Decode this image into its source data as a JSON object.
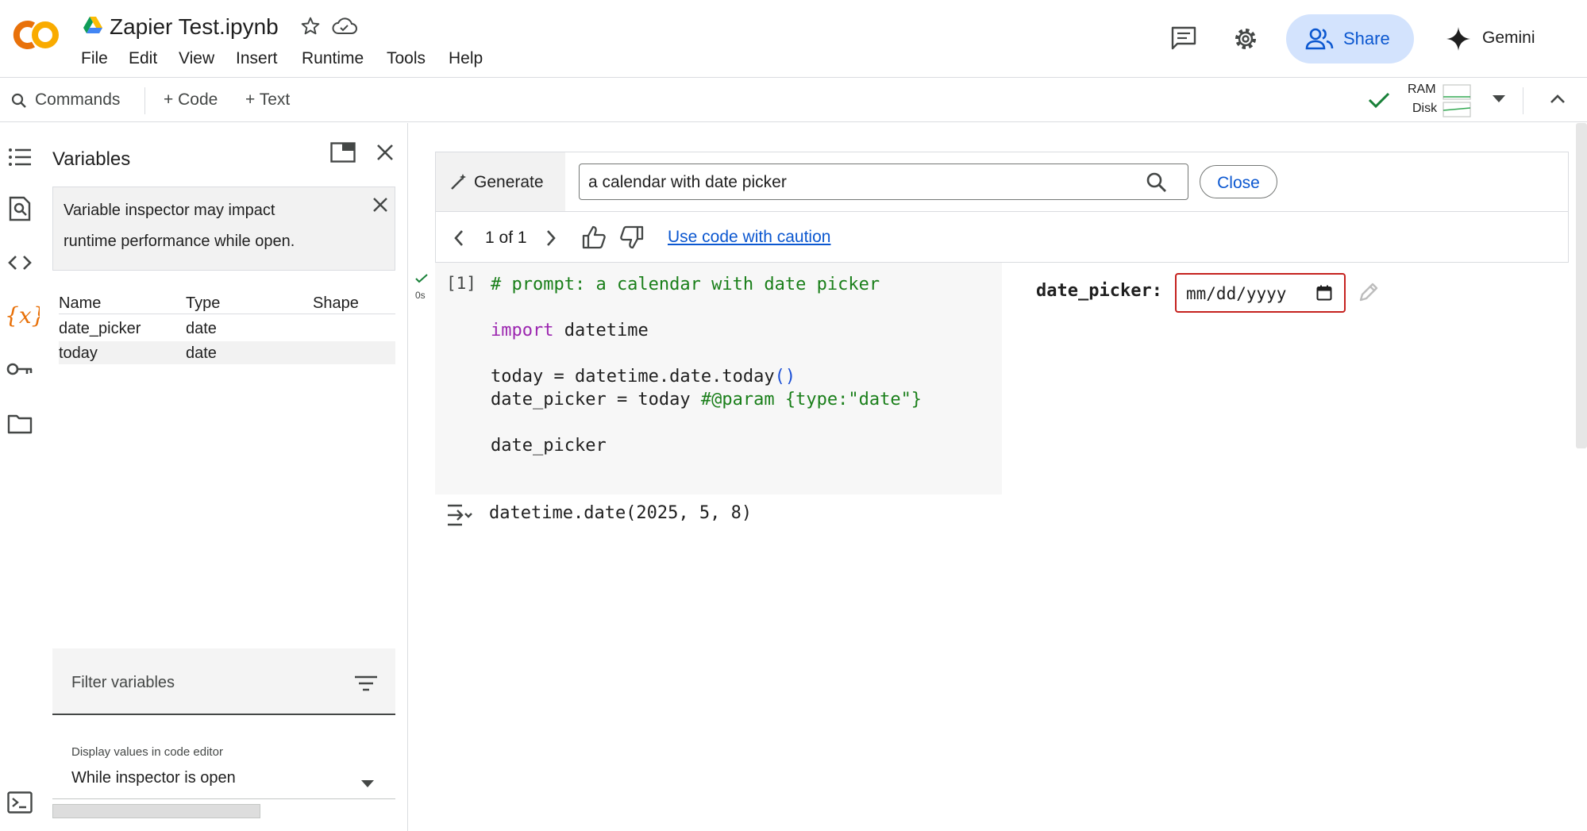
{
  "header": {
    "title": "Zapier Test.ipynb",
    "menu": [
      "File",
      "Edit",
      "View",
      "Insert",
      "Runtime",
      "Tools",
      "Help"
    ],
    "share_label": "Share",
    "gemini_label": "Gemini"
  },
  "toolbar": {
    "commands_label": "Commands",
    "add_code_label": "+ Code",
    "add_text_label": "+ Text",
    "ram_label": "RAM",
    "disk_label": "Disk"
  },
  "variables": {
    "title": "Variables",
    "notice": [
      "Variable inspector may impact",
      "runtime performance while open."
    ],
    "columns": [
      "Name",
      "Type",
      "Shape"
    ],
    "rows": [
      {
        "name": "date_picker",
        "type": "date",
        "shape": ""
      },
      {
        "name": "today",
        "type": "date",
        "shape": ""
      }
    ],
    "filter_placeholder": "Filter variables",
    "display_label": "Display values in code editor",
    "display_value": "While inspector is open"
  },
  "generate": {
    "label": "Generate",
    "prompt_value": "a calendar with date picker",
    "close_label": "Close",
    "pager": "1 of 1",
    "caution_link": "Use code with caution"
  },
  "cell": {
    "exec_count": "[1]",
    "exec_time": "0s",
    "output": "datetime.date(2025, 5, 8)"
  },
  "form": {
    "param_label": "date_picker:",
    "date_placeholder": "mm/dd/yyyy"
  },
  "colors": {
    "accent": "#0b57d0",
    "share_bg": "#d3e3fd",
    "logo_orange": "#f9ab00",
    "logo_dark": "#e8710a",
    "check_green": "#188038",
    "input_border": "#c5221f"
  }
}
